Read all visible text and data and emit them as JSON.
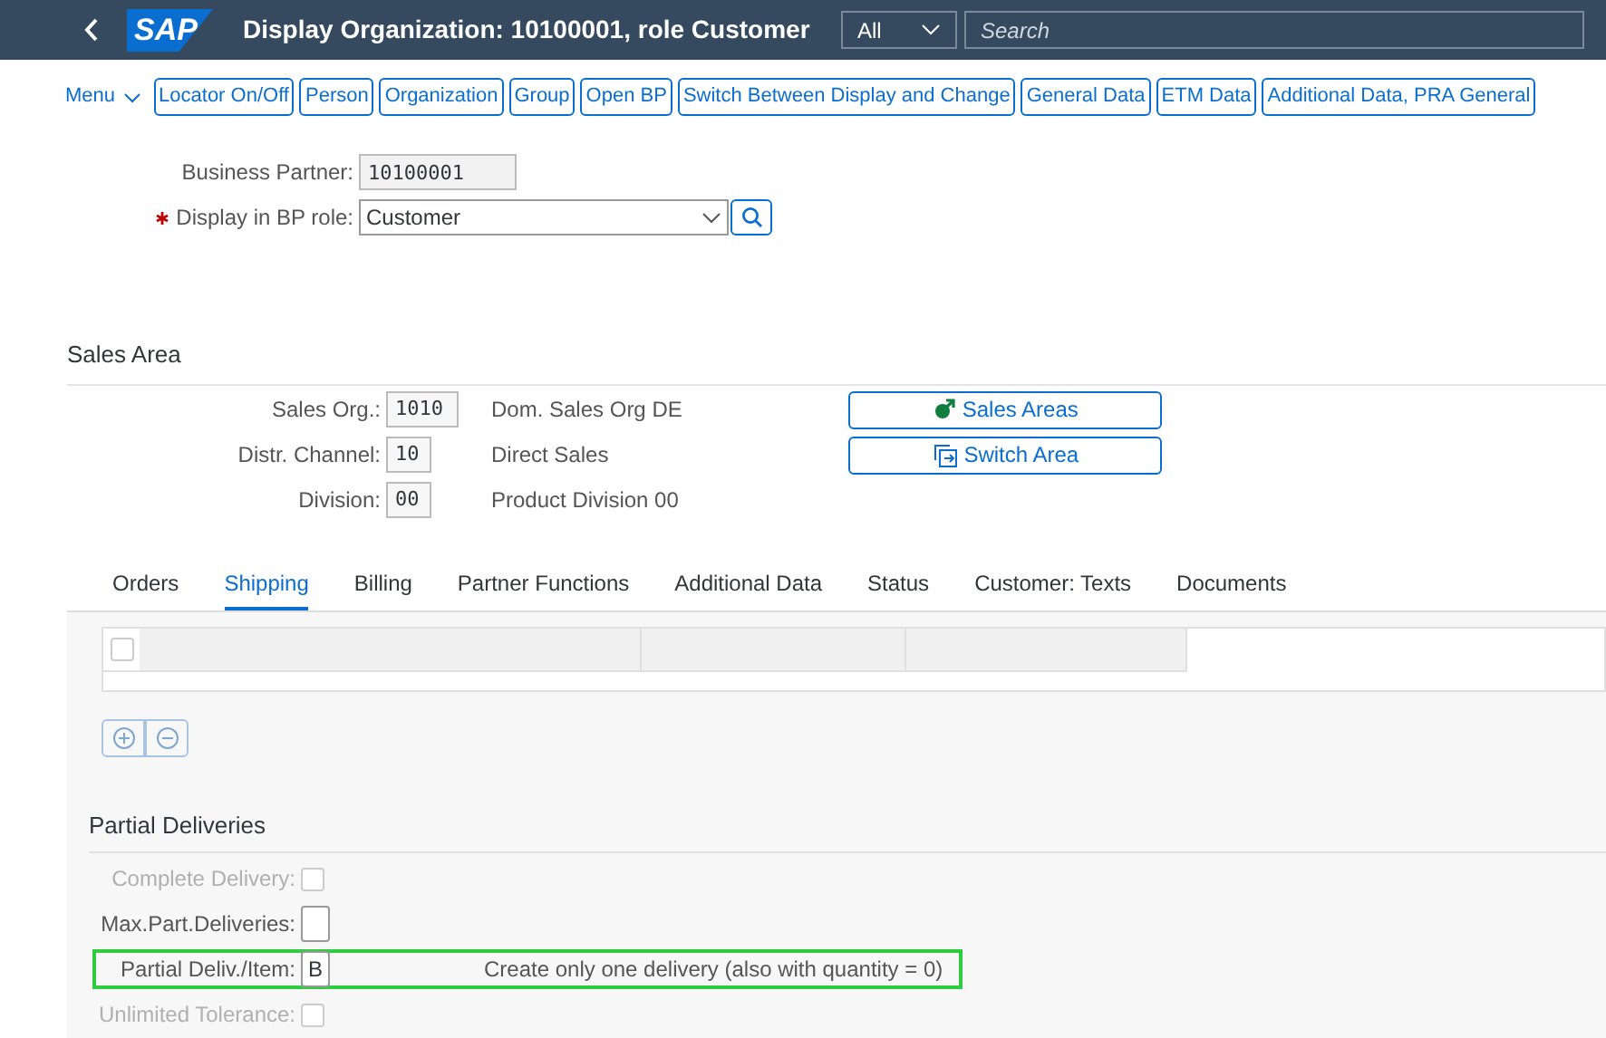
{
  "header": {
    "title": "Display Organization: 10100001, role Customer",
    "logo": "SAP",
    "scope": "All",
    "search": {
      "placeholder": "Search"
    }
  },
  "toolbar": {
    "menu": "Menu",
    "buttons": [
      "Locator On/Off",
      "Person",
      "Organization",
      "Group",
      "Open BP",
      "Switch Between Display and Change",
      "General Data",
      "ETM Data",
      "Additional Data, PRA General"
    ]
  },
  "partner": {
    "label": "Business Partner:",
    "value": "10100001",
    "role_label": "Display in BP role:",
    "required": true,
    "role_value": "Customer"
  },
  "sales_area": {
    "title": "Sales Area",
    "fields": [
      {
        "label": "Sales Org.:",
        "value": "1010",
        "description": "Dom. Sales Org DE"
      },
      {
        "label": "Distr. Channel:",
        "value": "10",
        "description": "Direct Sales"
      },
      {
        "label": "Division:",
        "value": "00",
        "description": "Product Division 00"
      }
    ],
    "buttons": [
      {
        "kind": "areas",
        "label": "Sales Areas"
      },
      {
        "kind": "switch",
        "label": "Switch Area"
      }
    ]
  },
  "tabs": [
    {
      "label": "Orders",
      "selected": false
    },
    {
      "label": "Shipping",
      "selected": true
    },
    {
      "label": "Billing",
      "selected": false
    },
    {
      "label": "Partner Functions",
      "selected": false
    },
    {
      "label": "Additional Data",
      "selected": false
    },
    {
      "label": "Status",
      "selected": false
    },
    {
      "label": "Customer: Texts",
      "selected": false
    },
    {
      "label": "Documents",
      "selected": false
    }
  ],
  "table": {
    "row_checked": false
  },
  "partial_deliveries": {
    "title": "Partial Deliveries",
    "rows": [
      {
        "kind": "checkbox",
        "label": "Complete Delivery:",
        "disabled": true,
        "checked": false,
        "highlighted": false
      },
      {
        "kind": "field",
        "label": "Max.Part.Deliveries:",
        "disabled": false,
        "highlighted": false
      },
      {
        "kind": "field",
        "label": "Partial Deliv./Item:",
        "value": "B",
        "description": "Create only one delivery (also with quantity = 0)",
        "disabled": false,
        "highlighted": true
      },
      {
        "kind": "checkbox",
        "label": "Unlimited Tolerance:",
        "disabled": true,
        "checked": false,
        "highlighted": false
      }
    ]
  }
}
